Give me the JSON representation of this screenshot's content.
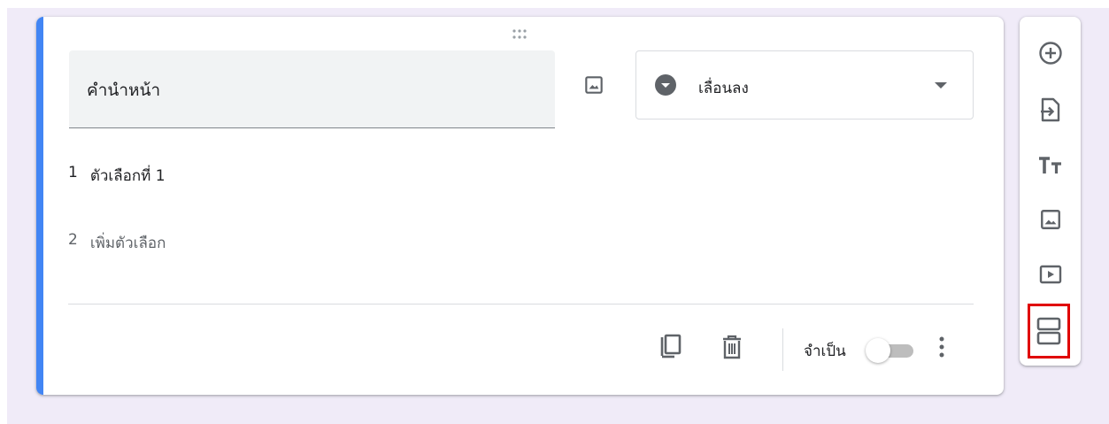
{
  "question": {
    "title": "คำนำหน้า",
    "type_label": "เลื่อนลง",
    "options": [
      {
        "number": "1",
        "label": "ตัวเลือกที่ 1"
      },
      {
        "number": "2",
        "label": "เพิ่มตัวเลือก"
      }
    ],
    "required_label": "จำเป็น",
    "required": false
  },
  "colors": {
    "accent": "#4285f4",
    "background": "#f0ebf8",
    "icon": "#5f6368",
    "highlight": "#e00000"
  },
  "icons": {
    "drag": "drag-handle-icon",
    "image": "image-icon",
    "type": "dropdown-circle-icon",
    "caret": "caret-down-icon",
    "copy": "copy-icon",
    "delete": "trash-icon",
    "more": "more-vert-icon",
    "toolbar": [
      "add-circle-icon",
      "import-icon",
      "title-text-icon",
      "image-icon",
      "video-icon",
      "section-icon"
    ]
  }
}
